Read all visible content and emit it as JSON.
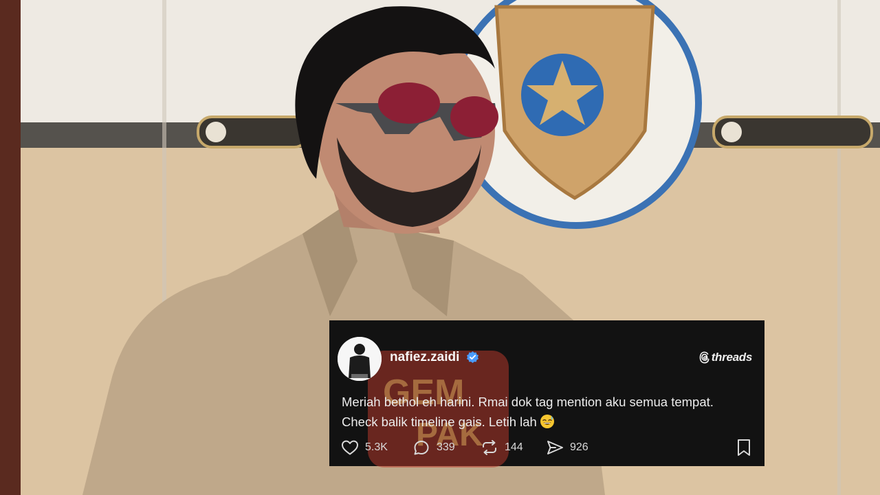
{
  "post": {
    "username": "nafiez.zaidi",
    "brand": "threads",
    "text_line1": "Meriah bethol eh harini. Rmai dok tag mention aku semua tempat.",
    "text_line2": "Check balik timeline gais. Letih lah",
    "likes": "5.3K",
    "replies": "339",
    "reposts": "144",
    "shares": "926"
  },
  "watermark": {
    "line1": "GEM",
    "line2": "PAK"
  },
  "colors": {
    "card_bg": "#121212",
    "verified": "#4a9bff",
    "watermark": "#c0392b"
  }
}
